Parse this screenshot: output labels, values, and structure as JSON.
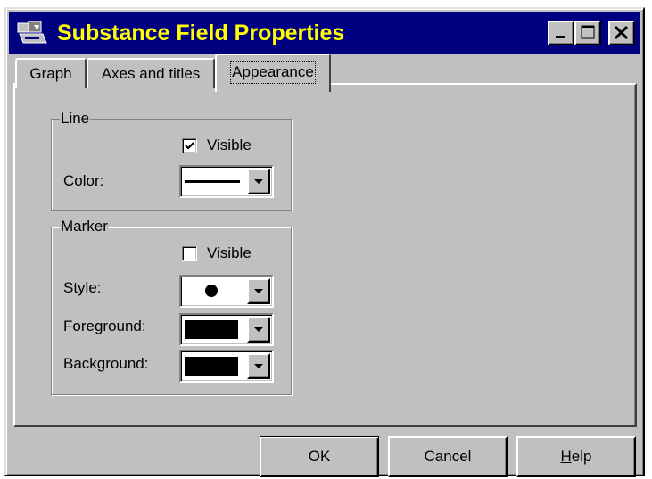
{
  "window": {
    "title": "Substance Field Properties",
    "title_color": "#ffff00",
    "titlebar_color": "#000080",
    "minimize_icon": "minimize-icon",
    "maximize_icon": "maximize-icon",
    "close_icon": "close-icon"
  },
  "tabs": [
    {
      "label": "Graph",
      "active": false
    },
    {
      "label": "Axes and titles",
      "active": false
    },
    {
      "label": "Appearance",
      "active": true
    }
  ],
  "line_group": {
    "title": "Line",
    "visible_label": "Visible",
    "visible_checked": true,
    "color_label": "Color:",
    "color_value": "solid-line-black"
  },
  "marker_group": {
    "title": "Marker",
    "visible_label": "Visible",
    "visible_checked": false,
    "style_label": "Style:",
    "style_value": "filled-circle",
    "foreground_label": "Foreground:",
    "foreground_value": "#000000",
    "background_label": "Background:",
    "background_value": "#000000"
  },
  "buttons": {
    "ok": "OK",
    "cancel": "Cancel",
    "help_accel": "H",
    "help_rest": "elp"
  }
}
